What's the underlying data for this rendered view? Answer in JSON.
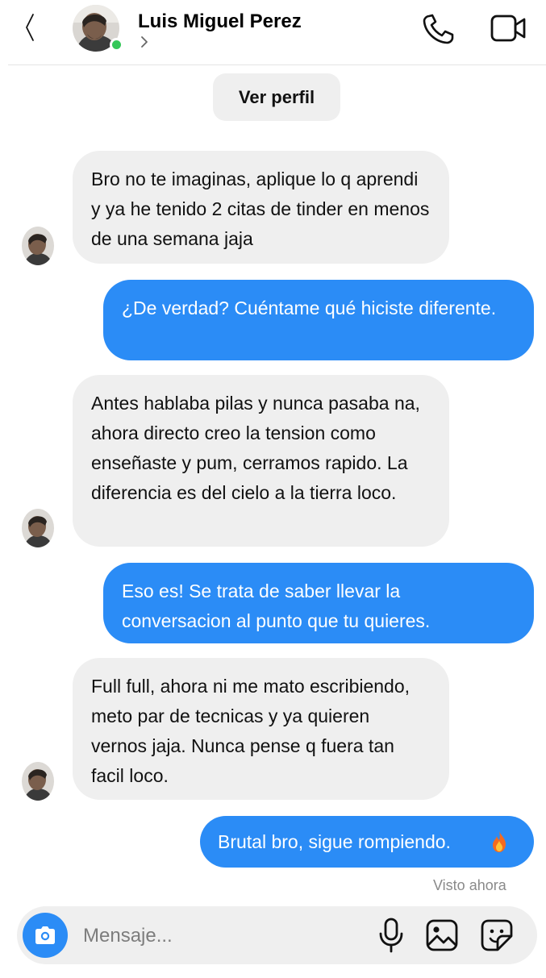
{
  "header": {
    "contact_name": "Luis Miguel Perez"
  },
  "profile_button_label": "Ver perfil",
  "messages": [
    {
      "direction": "incoming",
      "text": "Bro no te imaginas, aplique lo q aprendi y ya he tenido 2 citas de tinder en menos de una semana jaja"
    },
    {
      "direction": "outgoing",
      "text": "¿De verdad? Cuéntame qué hiciste diferente."
    },
    {
      "direction": "incoming",
      "text": "Antes hablaba pilas y nunca pasaba na, ahora directo creo la tension como enseñaste y pum, cerramos rapido. La diferencia es del cielo a la tierra loco."
    },
    {
      "direction": "outgoing",
      "text": "Eso es! Se trata de saber llevar la conversacion al punto que tu quieres."
    },
    {
      "direction": "incoming",
      "text": "Full full, ahora ni me mato escribiendo, meto par de tecnicas y ya quieren vernos jaja. Nunca pense q fuera tan facil loco."
    },
    {
      "direction": "outgoing",
      "text": "Brutal bro, sigue rompiendo.",
      "emoji": "fire-emoji"
    }
  ],
  "seen_status": "Visto ahora",
  "composer": {
    "placeholder": "Mensaje..."
  },
  "colors": {
    "outgoing_bubble": "#2b8cf6",
    "incoming_bubble": "#efefef",
    "online_indicator": "#35c759",
    "accent": "#2b8cf6"
  },
  "icons": [
    "back-chevron-icon",
    "chevron-right-icon",
    "phone-icon",
    "video-camera-icon",
    "camera-icon",
    "microphone-icon",
    "image-icon",
    "sticker-icon",
    "fire-emoji"
  ]
}
